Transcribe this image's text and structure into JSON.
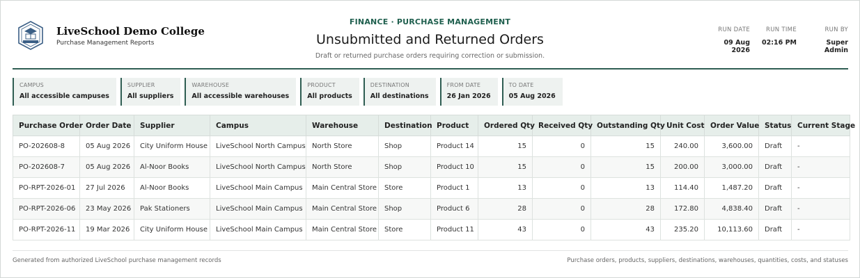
{
  "brand": {
    "name": "LiveSchool Demo College",
    "subtitle": "Purchase Management Reports"
  },
  "header": {
    "eyebrow": "FINANCE · PURCHASE MANAGEMENT",
    "title": "Unsubmitted and Returned Orders",
    "subtitle": "Draft or returned purchase orders requiring correction or submission."
  },
  "run": {
    "date_label": "RUN DATE",
    "date": "09 Aug 2026",
    "time_label": "RUN TIME",
    "time": "02:16 PM",
    "by_label": "RUN BY",
    "by": "Super Admin"
  },
  "filters": [
    {
      "label": "CAMPUS",
      "value": "All accessible campuses"
    },
    {
      "label": "SUPPLIER",
      "value": "All suppliers"
    },
    {
      "label": "WAREHOUSE",
      "value": "All accessible warehouses"
    },
    {
      "label": "PRODUCT",
      "value": "All products"
    },
    {
      "label": "DESTINATION",
      "value": "All destinations"
    },
    {
      "label": "FROM DATE",
      "value": "26 Jan 2026"
    },
    {
      "label": "TO DATE",
      "value": "05 Aug 2026"
    }
  ],
  "table": {
    "columns": [
      "Purchase Order",
      "Order Date",
      "Supplier",
      "Campus",
      "Warehouse",
      "Destination",
      "Product",
      "Ordered Qty",
      "Received Qty",
      "Outstanding Qty",
      "Unit Cost",
      "Order Value",
      "Status",
      "Current Stage"
    ],
    "rows": [
      [
        "PO-202608-8",
        "05 Aug 2026",
        "City Uniform House",
        "LiveSchool North Campus",
        "North Store",
        "Shop",
        "Product 14",
        "15",
        "0",
        "15",
        "240.00",
        "3,600.00",
        "Draft",
        "-"
      ],
      [
        "PO-202608-7",
        "05 Aug 2026",
        "Al-Noor Books",
        "LiveSchool North Campus",
        "North Store",
        "Shop",
        "Product 10",
        "15",
        "0",
        "15",
        "200.00",
        "3,000.00",
        "Draft",
        "-"
      ],
      [
        "PO-RPT-2026-01",
        "27 Jul 2026",
        "Al-Noor Books",
        "LiveSchool Main Campus",
        "Main Central Store",
        "Store",
        "Product 1",
        "13",
        "0",
        "13",
        "114.40",
        "1,487.20",
        "Draft",
        "-"
      ],
      [
        "PO-RPT-2026-06",
        "23 May 2026",
        "Pak Stationers",
        "LiveSchool Main Campus",
        "Main Central Store",
        "Shop",
        "Product 6",
        "28",
        "0",
        "28",
        "172.80",
        "4,838.40",
        "Draft",
        "-"
      ],
      [
        "PO-RPT-2026-11",
        "19 Mar 2026",
        "City Uniform House",
        "LiveSchool Main Campus",
        "Main Central Store",
        "Store",
        "Product 11",
        "43",
        "0",
        "43",
        "235.20",
        "10,113.60",
        "Draft",
        "-"
      ]
    ]
  },
  "footer": {
    "left": "Generated from authorized LiveSchool purchase management records",
    "right": "Purchase orders, products, suppliers, destinations, warehouses, quantities, costs, and statuses"
  },
  "colors": {
    "accent": "#2e5d52",
    "eyebrow": "#1f5f4e",
    "header_bg": "#e6eeea",
    "filter_bg": "#eef2f0"
  }
}
